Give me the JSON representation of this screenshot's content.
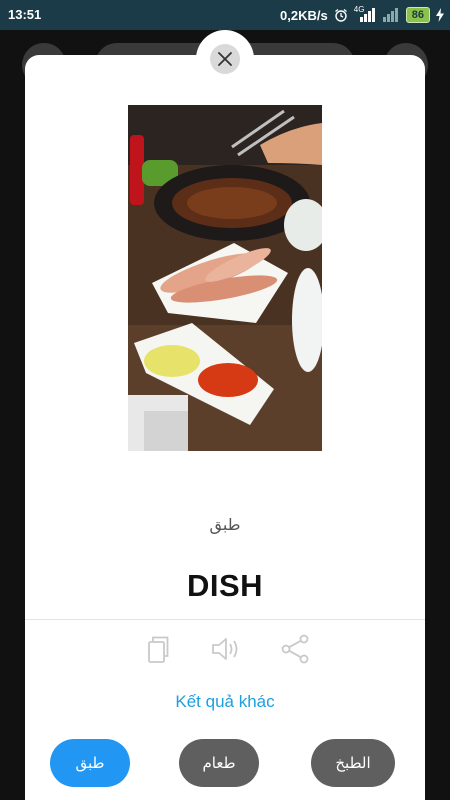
{
  "status_bar": {
    "time": "13:51",
    "net_speed": "0,2KB/s",
    "network_type": "4G",
    "battery": "86",
    "icons": [
      "alarm-icon",
      "signal-icon",
      "wifi-icon",
      "battery-icon",
      "charging-icon"
    ]
  },
  "card": {
    "close_icon": "close-icon",
    "image_alt": "dish-photo",
    "arabic_word": "طبق",
    "english_word": "DISH",
    "actions": [
      "copy-icon",
      "speaker-icon",
      "share-icon"
    ],
    "more_results": "Kết quả khác"
  },
  "choices": {
    "left": "طبق",
    "middle": "طعام",
    "right": "الطبخ"
  },
  "colors": {
    "accent": "#2196f3",
    "link": "#1d9fe0",
    "choice_gray": "#5f5f5f",
    "status_bar": "#1a3b47"
  }
}
